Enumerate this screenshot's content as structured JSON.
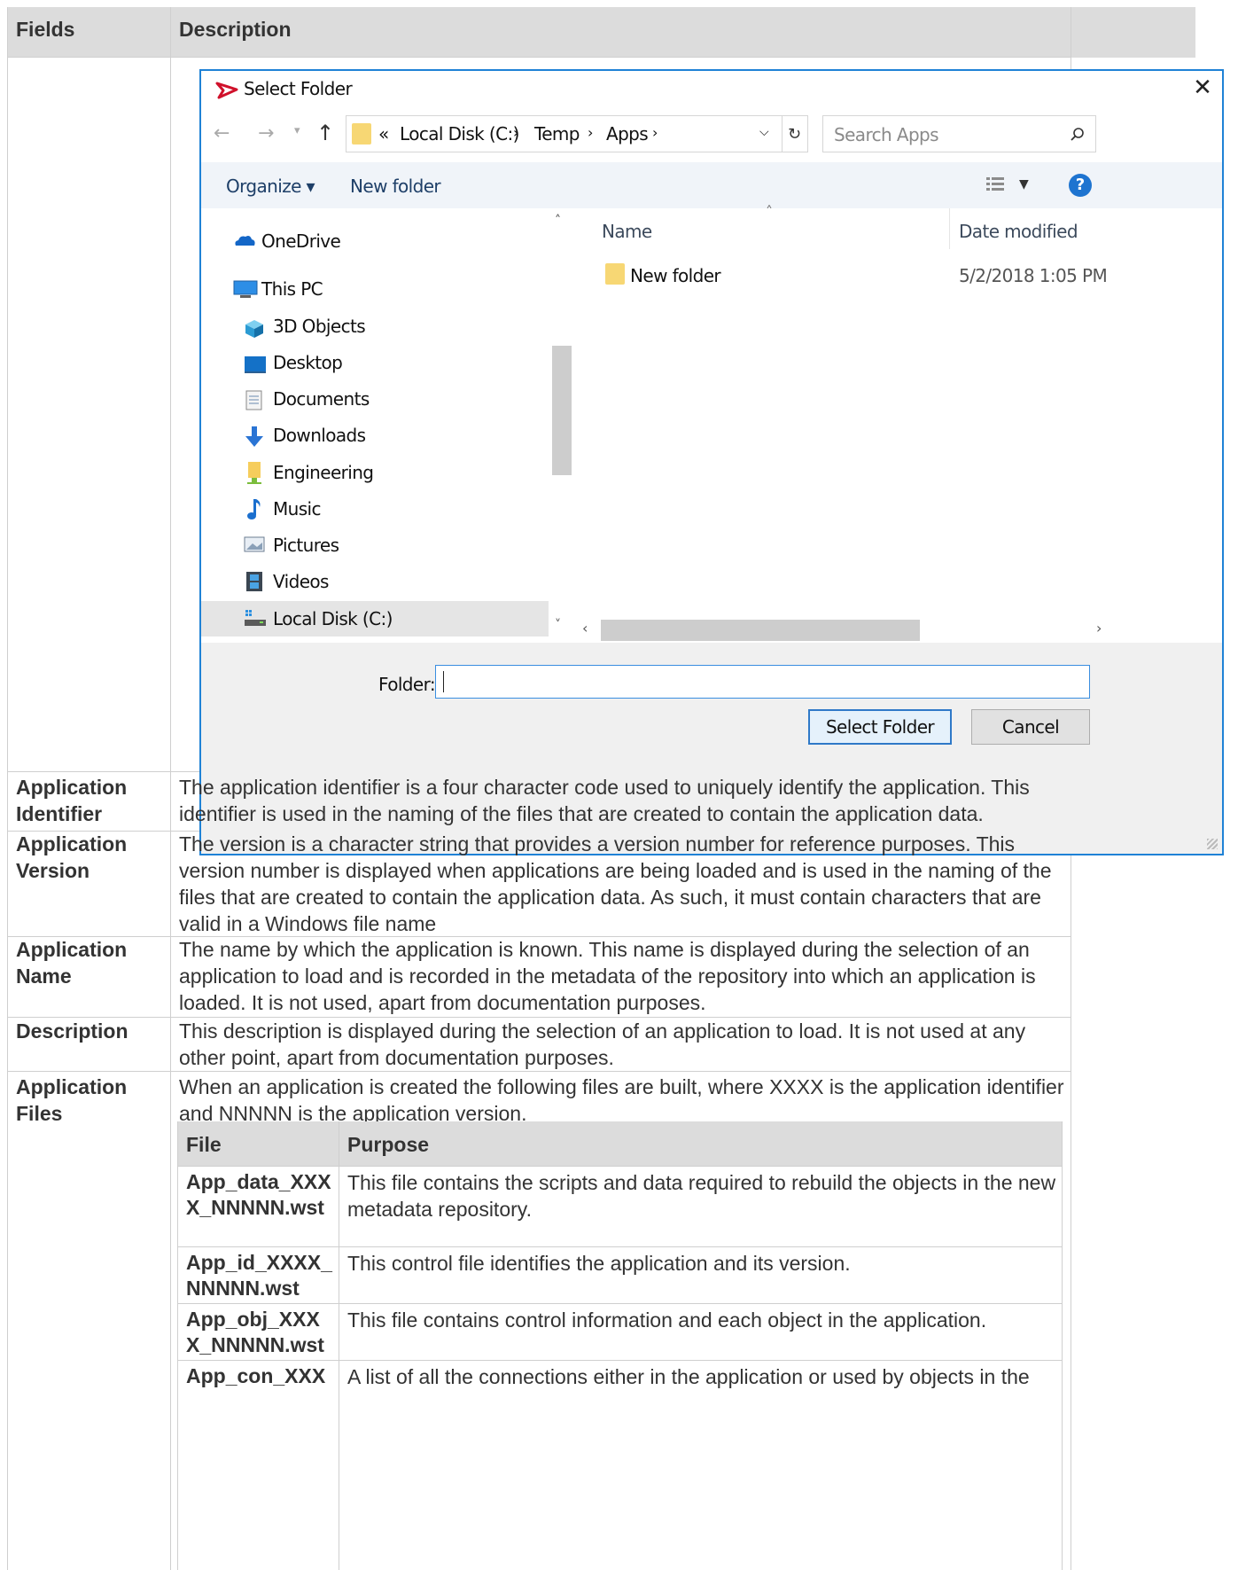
{
  "table": {
    "col_fields": "Fields",
    "col_description": "Description",
    "rows": [
      {
        "field": "Application Identifier",
        "description": "The application identifier is a four character code used to uniquely identify the application. This identifier is used in the naming of the files that are created to contain the application data."
      },
      {
        "field": "Application Version",
        "description": "The version is a character string that provides a version number for reference purposes. This version number is displayed when applications are being loaded and is used in the naming of the files that are created to contain the application data. As such, it must contain characters that are valid in a Windows file name"
      },
      {
        "field": "Application Name",
        "description": "The name by which the application is known. This name is displayed during the selection of an application to load and is recorded in the metadata of the repository into which an application is loaded. It is not used, apart from documentation purposes."
      },
      {
        "field": "Description",
        "description": "This description is displayed during the selection of an application to load. It is not used at any other point, apart from documentation purposes."
      },
      {
        "field": "Application Files",
        "description": "When an application is created the following files are built, where XXXX is the application identifier and NNNNN is the application version."
      }
    ]
  },
  "files_table": {
    "col_file": "File",
    "col_purpose": "Purpose",
    "rows": [
      {
        "file": "App_data_XXXX_NNNNN.wst",
        "purpose": "This file contains the scripts and data required to rebuild the objects in the new metadata repository."
      },
      {
        "file": "App_id_XXXX_NNNNN.wst",
        "purpose": "This control file identifies the application and its version."
      },
      {
        "file": "App_obj_XXXX_NNNNN.wst",
        "purpose": "This file contains control information and each object in the application."
      },
      {
        "file": "App_con_XXX",
        "purpose": "A list of all the connections either in the application or used by objects in the"
      }
    ]
  },
  "dialog": {
    "title": "Select Folder",
    "breadcrumb": {
      "overflow": "«",
      "items": [
        "Local Disk (C:)",
        "Temp",
        "Apps"
      ]
    },
    "search_placeholder": "Search Apps",
    "toolbar": {
      "organize": "Organize ▾",
      "new_folder": "New folder"
    },
    "nav_items": [
      "OneDrive",
      "This PC",
      "3D Objects",
      "Desktop",
      "Documents",
      "Downloads",
      "Engineering",
      "Music",
      "Pictures",
      "Videos",
      "Local Disk (C:)"
    ],
    "columns": {
      "name": "Name",
      "date_modified": "Date modified"
    },
    "files": [
      {
        "name": "New folder",
        "date": "5/2/2018 1:05 PM"
      }
    ],
    "folder_label": "Folder:",
    "folder_value": "",
    "select_button": "Select Folder",
    "cancel_button": "Cancel",
    "accent_color": "#1f82d6",
    "selected_nav": "Local Disk (C:)"
  }
}
